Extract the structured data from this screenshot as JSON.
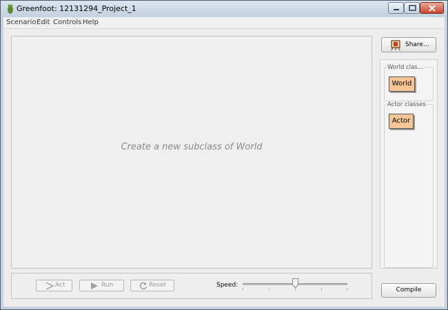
{
  "window": {
    "title": "Greenfoot: 12131294_Project_1"
  },
  "menu": [
    "Scenario",
    "Edit",
    "Controls",
    "Help"
  ],
  "world": {
    "message": "Create a new subclass of World"
  },
  "controls": {
    "act_label": "Act",
    "run_label": "Run",
    "reset_label": "Reset",
    "speed_label": "Speed:",
    "speed_fraction": 0.5
  },
  "sidebar": {
    "share_label": "Share...",
    "world_group_title": "World clas...",
    "world_class": "World",
    "actor_group_title": "Actor classes",
    "actor_class": "Actor",
    "compile_label": "Compile"
  },
  "colors": {
    "class_box": "#f7c596",
    "title_bar": "#c3d0dd",
    "close_button": "#c8452b"
  }
}
